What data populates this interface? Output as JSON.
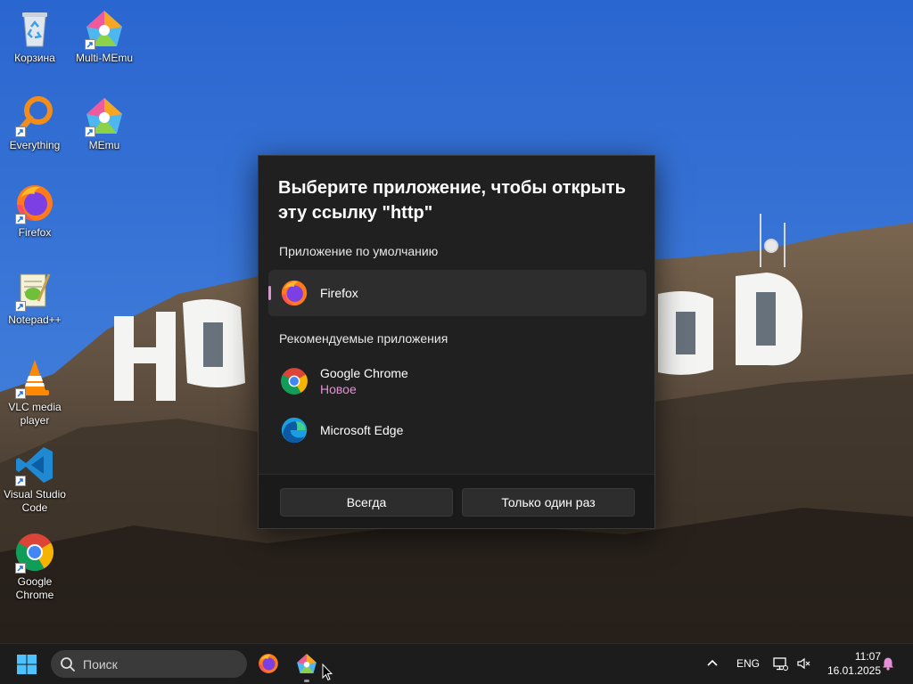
{
  "desktop": {
    "icons": [
      {
        "label": "Корзина"
      },
      {
        "label": "Multi-MEmu"
      },
      {
        "label": "Everything"
      },
      {
        "label": "MEmu"
      },
      {
        "label": "Firefox"
      },
      {
        "label": "Notepad++"
      },
      {
        "label": "VLC media player"
      },
      {
        "label": "Visual Studio Code"
      },
      {
        "label": "Google Chrome"
      }
    ]
  },
  "dialog": {
    "title": "Выберите приложение, чтобы открыть эту ссылку \"http\"",
    "default_section": "Приложение по умолчанию",
    "default_app": {
      "name": "Firefox",
      "icon": "firefox-icon"
    },
    "recommended_section": "Рекомендуемые приложения",
    "recommended_apps": [
      {
        "name": "Google Chrome",
        "badge": "Новое",
        "icon": "chrome-icon"
      },
      {
        "name": "Microsoft Edge",
        "icon": "edge-icon"
      }
    ],
    "buttons": {
      "always": "Всегда",
      "once": "Только один раз"
    },
    "accent_color": "#e58fd6"
  },
  "taskbar": {
    "search_placeholder": "Поиск",
    "apps": [
      {
        "name": "Firefox",
        "icon": "firefox-icon"
      },
      {
        "name": "MEmu",
        "icon": "memu-icon"
      }
    ],
    "language": "ENG",
    "time": "11:07",
    "date": "16.01.2025"
  }
}
